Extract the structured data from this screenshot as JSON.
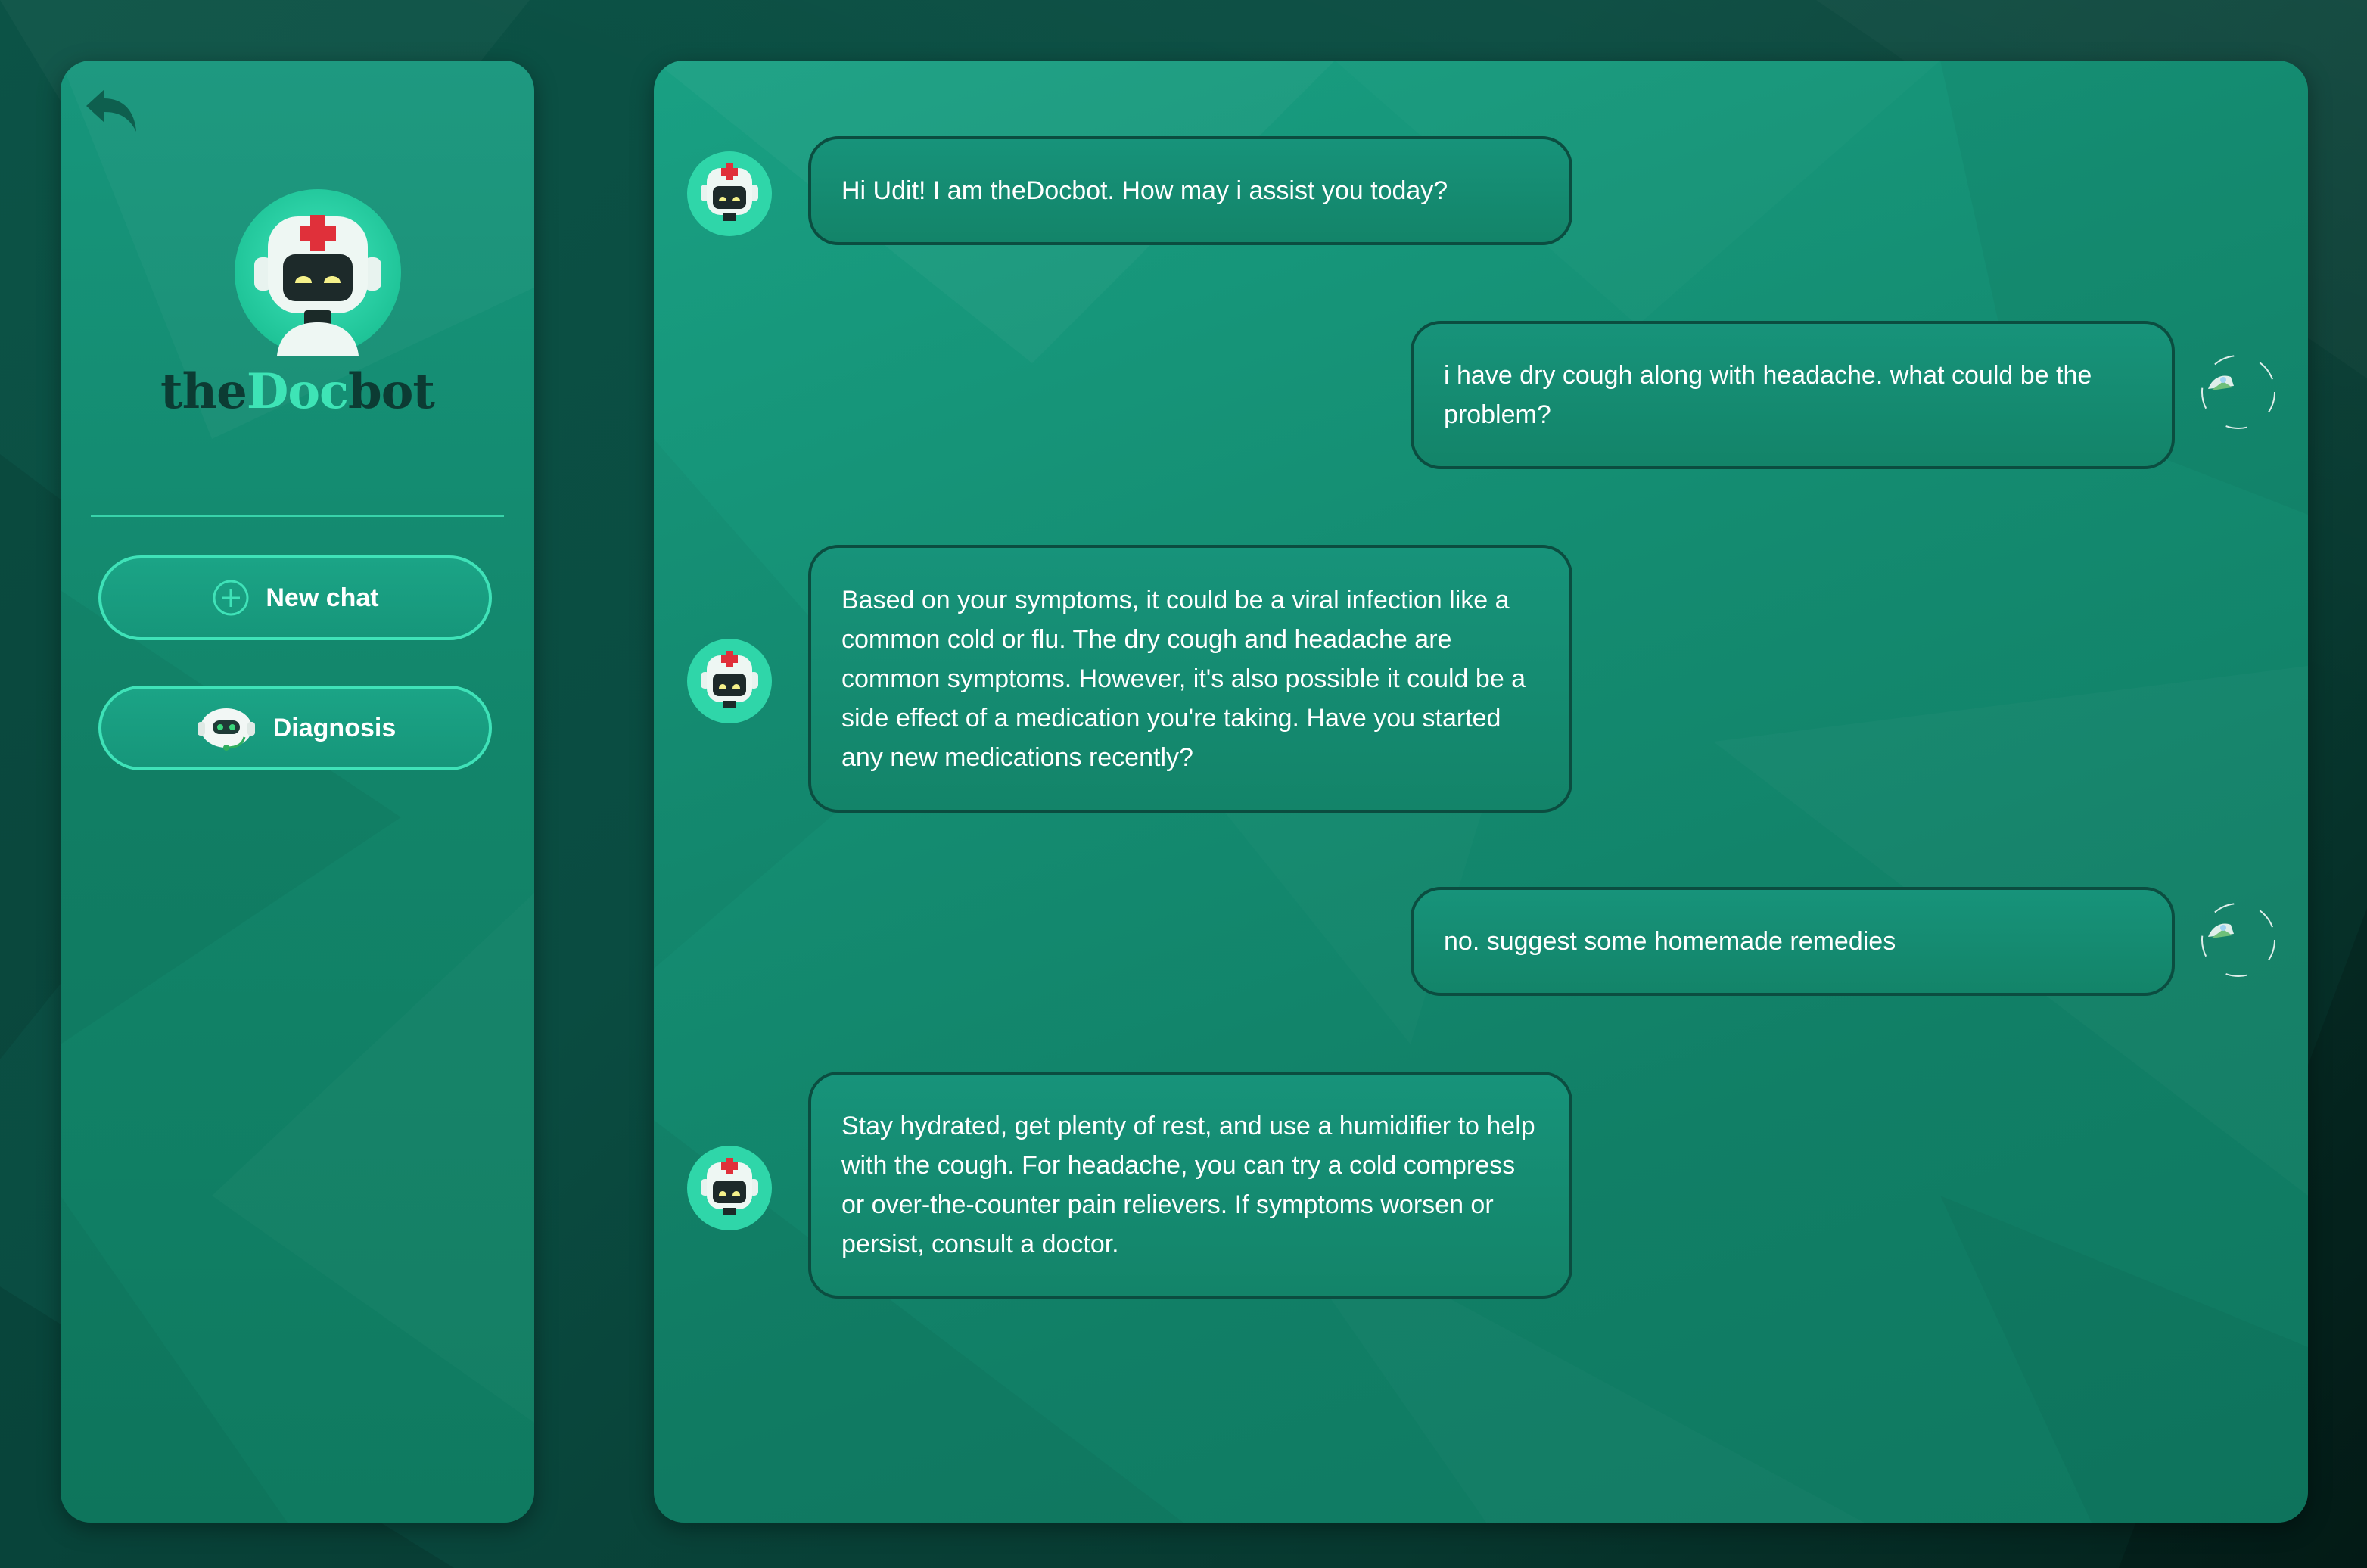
{
  "app": {
    "brand_parts": [
      "the",
      "Doc",
      "bot"
    ]
  },
  "sidebar": {
    "back_icon": "back-arrow-icon",
    "new_chat_label": "New chat",
    "new_chat_icon": "plus-circle-icon",
    "diagnosis_label": "Diagnosis",
    "diagnosis_icon": "robot-headset-icon"
  },
  "chat": {
    "messages": [
      {
        "sender": "bot",
        "text": "Hi Udit! I am theDocbot. How may i assist you today?"
      },
      {
        "sender": "user",
        "text": "i have dry cough along with headache. what could be the problem?"
      },
      {
        "sender": "bot",
        "text": "Based on your symptoms, it could be a viral infection like a common cold or flu. The dry cough and headache are common symptoms. However, it's also possible it could be a side effect of a medication you're taking. Have you started any new medications recently?"
      },
      {
        "sender": "user",
        "text": "no. suggest some homemade remedies"
      },
      {
        "sender": "bot",
        "text": "Stay hydrated, get plenty of rest, and use a humidifier to help with the cough. For headache, you can try a cold compress or over-the-counter pain relievers. If symptoms worsen or persist, consult a doctor."
      }
    ]
  },
  "colors": {
    "accent": "#3fe2b8",
    "panel": "#148c71",
    "background": "#0a4c41",
    "bubble_border": "#0b4d40",
    "brand_dark": "#0c3b33"
  }
}
